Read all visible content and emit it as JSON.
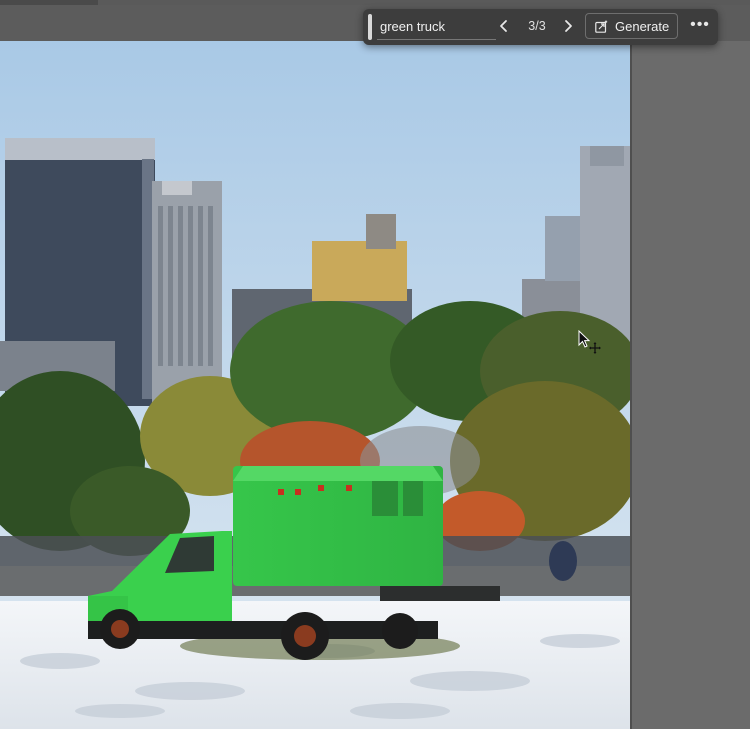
{
  "contextual_taskbar": {
    "prompt_value": "green truck",
    "variation_counter": "3/3",
    "generate_label": "Generate",
    "prev_icon": "chevron-left-icon",
    "next_icon": "chevron-right-icon",
    "more_icon": "more-options-icon",
    "more_glyph": "•••"
  },
  "canvas": {
    "scene": "city skyline, park trees, snowy ground, green box truck",
    "colors": {
      "sky": "#b9d3ea",
      "truck": "#35c94a",
      "snow": "#eef1f5",
      "trees": "#3e6a2c"
    }
  },
  "cursor": {
    "icon": "move-pointer-icon"
  }
}
